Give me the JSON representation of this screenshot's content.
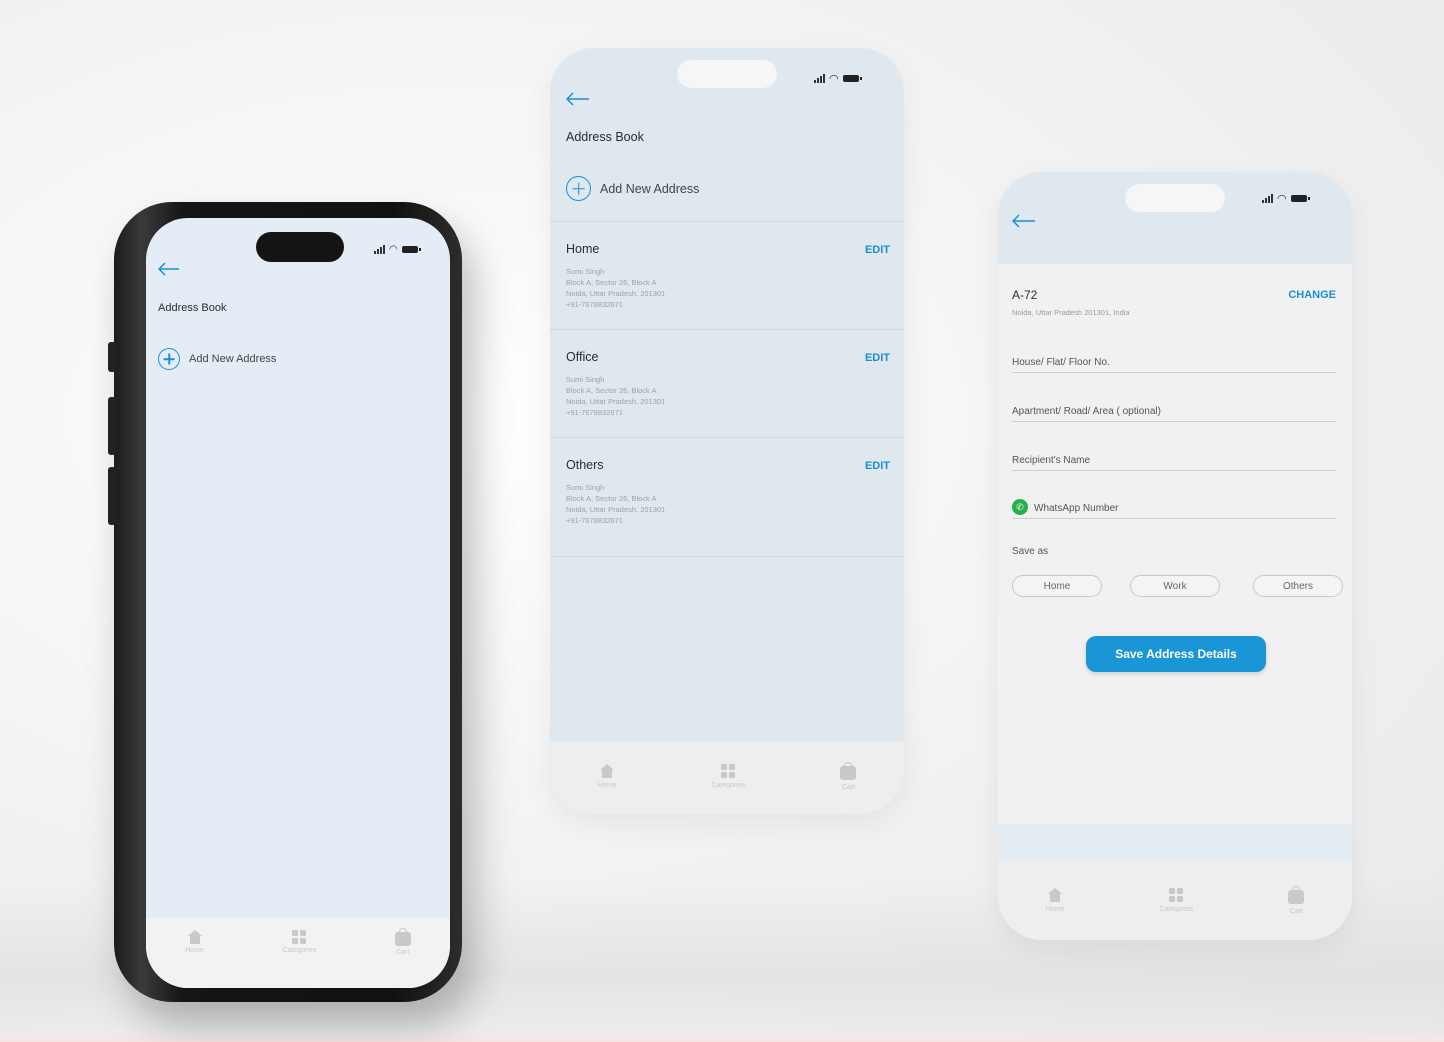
{
  "colors": {
    "accent": "#1a8fd6",
    "screen_bg": "#e4edf6",
    "button": "#1a96d6"
  },
  "phone1": {
    "page_title": "Address Book",
    "add_new": "Add New Address",
    "nav": [
      {
        "label": "Home",
        "icon": "home-icon"
      },
      {
        "label": "Categories",
        "icon": "grid-icon"
      },
      {
        "label": "Cart",
        "icon": "bag-icon"
      }
    ]
  },
  "phone2": {
    "page_title": "Address Book",
    "add_new": "Add New Address",
    "addresses": [
      {
        "name": "Home",
        "edit": "EDIT",
        "lines": [
          "Sumi Singh",
          "Block A, Sector 26, Block A",
          "Noida, Uttar Pradesh, 201301",
          "+91-7678832671"
        ]
      },
      {
        "name": "Office",
        "edit": "EDIT",
        "lines": [
          "Sumi Singh",
          "Block A, Sector 26, Block A",
          "Noida, Uttar Pradesh, 201301",
          "+91-7678832671"
        ]
      },
      {
        "name": "Others",
        "edit": "EDIT",
        "lines": [
          "Sumi Singh",
          "Block A, Sector 26, Block A",
          "Noida, Uttar Pradesh, 201301",
          "+91-7678832671"
        ]
      }
    ],
    "nav": [
      {
        "label": "Home",
        "icon": "home-icon"
      },
      {
        "label": "Categories",
        "icon": "grid-icon"
      },
      {
        "label": "Cart",
        "icon": "bag-icon"
      }
    ]
  },
  "phone3": {
    "location_title": "A-72",
    "location_sub": "Noida, Uttar Pradesh 201301, India",
    "change": "CHANGE",
    "fields": {
      "house": "House/ Flat/ Floor No.",
      "apartment": "Apartment/ Road/ Area ( optional)",
      "recipient": "Recipient's Name",
      "whatsapp": "WhatsApp Number"
    },
    "save_as_label": "Save as",
    "save_as_options": [
      "Home",
      "Work",
      "Others"
    ],
    "save_button": "Save Address Details",
    "nav": [
      {
        "label": "Home",
        "icon": "home-icon"
      },
      {
        "label": "Categories",
        "icon": "grid-icon"
      },
      {
        "label": "Cart",
        "icon": "bag-icon"
      }
    ]
  }
}
